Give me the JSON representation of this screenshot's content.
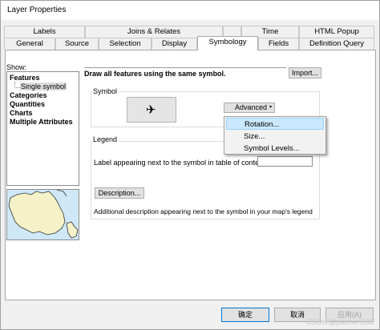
{
  "window": {
    "title": "Layer Properties"
  },
  "tabs_back": [
    "Labels",
    "Joins & Relates",
    "Time",
    "HTML Popup"
  ],
  "tabs_front": [
    "General",
    "Source",
    "Selection",
    "Display",
    "Symbology",
    "Fields",
    "Definition Query"
  ],
  "active_tab": "Symbology",
  "show": {
    "label": "Show:",
    "items": [
      "Features",
      "Single symbol",
      "Categories",
      "Quantities",
      "Charts",
      "Multiple Attributes"
    ]
  },
  "description": "Draw all features using the same symbol.",
  "import_button": "Import...",
  "symbol_group": {
    "label": "Symbol",
    "glyph": "✈",
    "advanced_button": "Advanced"
  },
  "advanced_menu": [
    "Rotation...",
    "Size...",
    "Symbol Levels..."
  ],
  "legend_group": {
    "label": "Legend",
    "toc_label": "Label appearing next to the symbol in table of contents:",
    "toc_value": "",
    "description_button": "Description...",
    "additional_text": "Additional description appearing next to the symbol in your map's legend"
  },
  "footer": {
    "ok": "确定",
    "cancel": "取消",
    "apply": "应用(A)"
  },
  "watermark": "CSDN @juechen333",
  "colors": {
    "menu_highlight": "#cce8ff",
    "ok_border": "#0078d7",
    "map_water": "#cfe8f7",
    "map_land": "#f6f2c8"
  }
}
